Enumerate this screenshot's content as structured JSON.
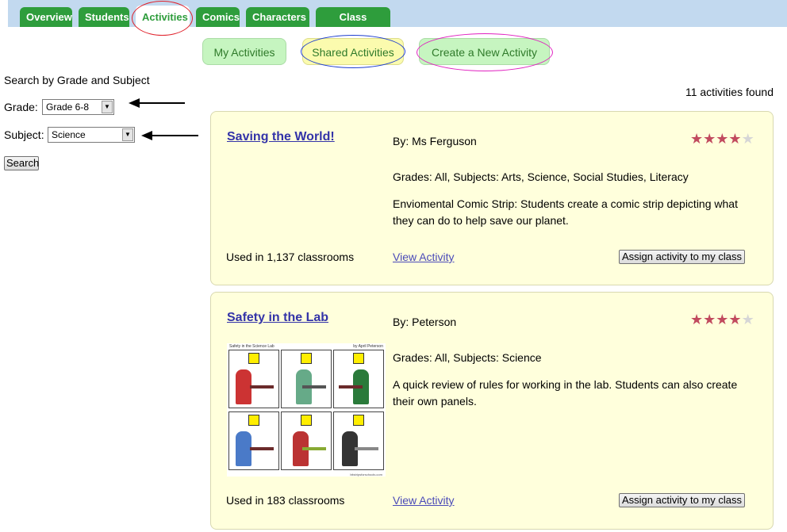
{
  "tabs": [
    "Overview",
    "Students",
    "Activities",
    "Comics",
    "Characters",
    "Class Settings"
  ],
  "subtabs": {
    "my": "My Activities",
    "shared": "Shared Activities",
    "create": "Create a New Activity"
  },
  "search": {
    "title": "Search by Grade and Subject",
    "grade_label": "Grade:",
    "grade_value": "Grade 6-8",
    "subject_label": "Subject:",
    "subject_value": "Science",
    "button": "Search"
  },
  "results_count": "11 activities found",
  "colors": {
    "tab_green": "#2e9d3c",
    "annotation_red": "#e0202a",
    "annotation_blue": "#1f3fcf",
    "annotation_magenta": "#e020c0",
    "star": "#c14a5e"
  },
  "activities": [
    {
      "title": "Saving the World!",
      "by": "By: Ms Ferguson",
      "grades": "Grades: All, Subjects: Arts, Science, Social Studies, Literacy",
      "description": "Enviomental Comic Strip: Students create a comic strip depicting what they can do to help save our planet.",
      "used": "Used in 1,137 classrooms",
      "view": "View Activity",
      "assign": "Assign activity to my class",
      "rating": 4,
      "rating_max": 5
    },
    {
      "title": "Safety in the Lab",
      "by": "By: Peterson",
      "grades": "Grades: All, Subjects: Science",
      "description": "A quick review of rules for working in the lab. Students can also create their own panels.",
      "used": "Used in 183 classrooms",
      "view": "View Activity",
      "assign": "Assign activity to my class",
      "rating": 4,
      "rating_max": 5,
      "thumbnail": {
        "title": "Safety in the Science Lab",
        "author": "by April Peterson",
        "footer": "bitstripsforschools.com"
      }
    }
  ]
}
